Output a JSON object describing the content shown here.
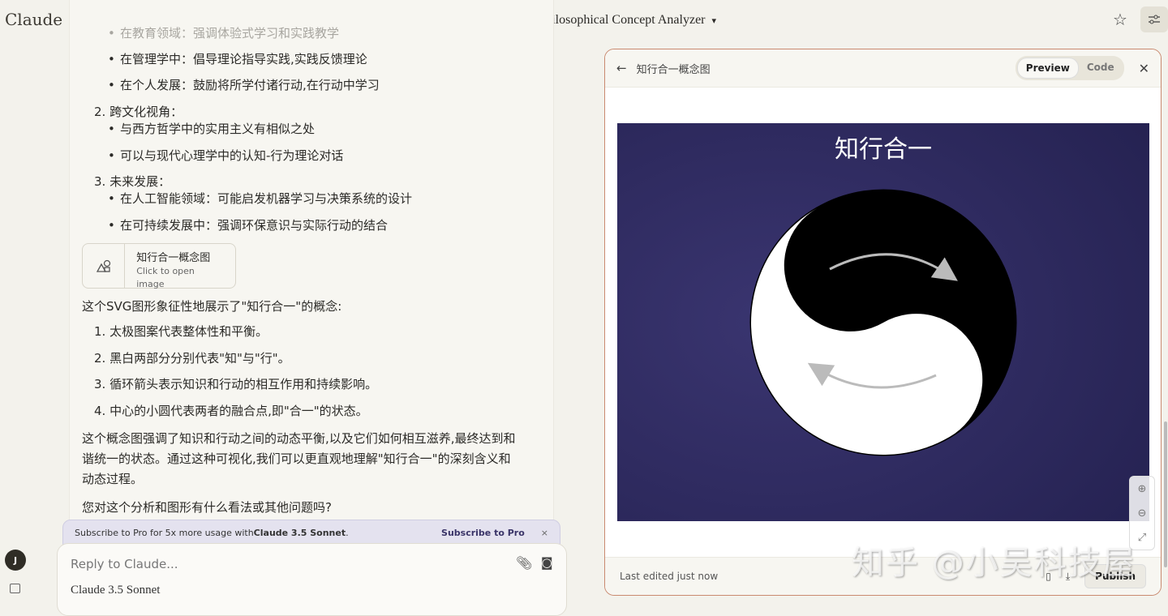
{
  "header": {
    "brand": "Claude",
    "conversation_title": "Philosophical Concept Analyzer"
  },
  "chat": {
    "items": [
      {
        "type": "bullet",
        "text": "在教育领域：强调体验式学习和实践教学"
      },
      {
        "type": "bullet",
        "text": "在管理学中：倡导理论指导实践,实践反馈理论"
      },
      {
        "type": "bullet",
        "text": "在个人发展：鼓励将所学付诸行动,在行动中学习"
      },
      {
        "type": "num",
        "text": "2. 跨文化视角："
      },
      {
        "type": "bullet",
        "text": "与西方哲学中的实用主义有相似之处"
      },
      {
        "type": "bullet",
        "text": "可以与现代心理学中的认知-行为理论对话"
      },
      {
        "type": "num",
        "text": "3. 未来发展："
      },
      {
        "type": "bullet",
        "text": "在人工智能领域：可能启发机器学习与决策系统的设计"
      },
      {
        "type": "bullet",
        "text": "在可持续发展中：强调环保意识与实际行动的结合"
      }
    ],
    "artifact_card": {
      "title": "知行合一概念图",
      "subtitle": "Click to open image"
    },
    "intro": "这个SVG图形象征性地展示了\"知行合一\"的概念:",
    "points": [
      "1. 太极图案代表整体性和平衡。",
      "2. 黑白两部分分别代表\"知\"与\"行\"。",
      "3. 循环箭头表示知识和行动的相互作用和持续影响。",
      "4. 中心的小圆代表两者的融合点,即\"合一\"的状态。"
    ],
    "summary_line1": "这个概念图强调了知识和行动之间的动态平衡,以及它们如何相互滋养,最终达到和",
    "summary_line2": "谐统一的状态。通过这种可视化,我们可以更直观地理解\"知行合一\"的深刻含义和",
    "summary_line3": "动态过程。",
    "question": "您对这个分析和图形有什么看法或其他问题吗?"
  },
  "banner": {
    "text": "Subscribe to Pro for 5x more usage with ",
    "model": "Claude 3.5 Sonnet",
    "link": "Subscribe to Pro",
    "close": "×"
  },
  "input": {
    "placeholder": "Reply to Claude...",
    "model": "Claude 3.5 Sonnet"
  },
  "user": {
    "initial": "J"
  },
  "artifact": {
    "title": "知行合一概念图",
    "tabs": [
      "Preview",
      "Code"
    ],
    "active_tab": "Preview",
    "image_title": "知行合一",
    "footer": "Last edited just now",
    "publish": "Publish"
  },
  "watermark": "知乎 @小吴科技屋",
  "colors": {
    "panel_border": "#c98a70",
    "canvas_bg": "#2d2a5e"
  }
}
